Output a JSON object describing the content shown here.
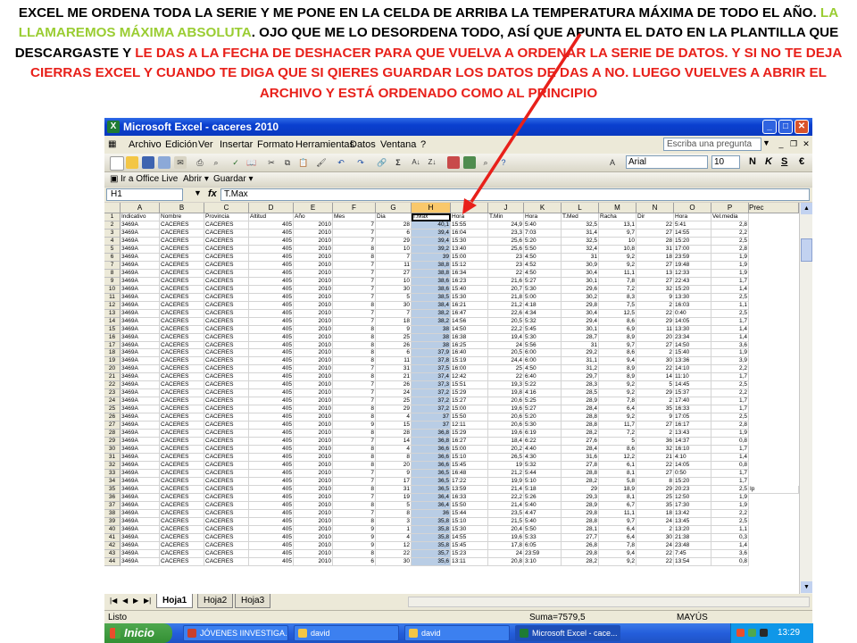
{
  "caption": {
    "part1": "EXCEL ME ORDENA TODA LA SERIE Y ME PONE EN LA CELDA DE ARRIBA LA TEMPERATURA MÁXIMA DE TODO EL AÑO.",
    "part2": "LA LLAMAREMOS MÁXIMA ABSOLUTA",
    "part3": ". OJO QUE ME LO DESORDENA TODO, ASÍ QUE APUNTA EL DATO EN LA PLANTILLA QUE DESCARGASTE Y",
    "part4": "LE DAS A LA FECHA DE DESHACER PARA QUE VUELVA A ORDENAR LA SERIE DE DATOS. Y SI NO TE DEJA CIERRAS EXCEL Y CUANDO TE DIGA QUE SI QIERES GUARDAR LOS DATOS DE DAS A NO. LUEGO VUELVES A ABRIR EL ARCHIVO Y ESTÁ ORDENADO COMO AL PRINCIPIO",
    "colors": {
      "black": "#000000",
      "green": "#9ACD32",
      "red": "#E8201A"
    }
  },
  "window": {
    "title": "Microsoft Excel - caceres 2010",
    "menu": [
      "Archivo",
      "Edición",
      "Ver",
      "Insertar",
      "Formato",
      "Herramientas",
      "Datos",
      "Ventana",
      "?"
    ],
    "help_placeholder": "Escriba una pregunta",
    "font_name": "Arial",
    "font_size": "10",
    "format_buttons": [
      "N",
      "K",
      "S",
      "€"
    ],
    "toolbar2": {
      "office_live": "Ir a Office Live",
      "open": "Abrir ▾",
      "save": "Guardar ▾"
    },
    "name_box": "H1",
    "fx_label": "fx",
    "formula_value": "T.Max"
  },
  "sheet": {
    "columns": [
      "A",
      "B",
      "C",
      "D",
      "E",
      "F",
      "G",
      "H",
      "I",
      "J",
      "K",
      "L",
      "M",
      "N",
      "O",
      "P"
    ],
    "partial_column_header": "Prec",
    "selected_column": "H",
    "header_row": [
      "Indicativo",
      "Nombre",
      "Provincia",
      "Altitud",
      "Año",
      "Mes",
      "Dia",
      "T.Max",
      "Hora",
      "T.Min",
      "Hora",
      "T.Med",
      "Racha",
      "Dir",
      "Hora",
      "Vel.media"
    ],
    "rows": [
      [
        "3469A",
        "CÁCERES",
        "CACERES",
        "405",
        "2010",
        "7",
        "28",
        "40,1",
        "15:55",
        "24,9",
        "5:40",
        "32,5",
        "13,1",
        "22",
        "5:41",
        "2,8"
      ],
      [
        "3469A",
        "CÁCERES",
        "CACERES",
        "405",
        "2010",
        "7",
        "6",
        "39,4",
        "16:04",
        "23,3",
        "7:03",
        "31,4",
        "9,7",
        "27",
        "14:55",
        "2,2"
      ],
      [
        "3469A",
        "CÁCERES",
        "CACERES",
        "405",
        "2010",
        "7",
        "29",
        "39,4",
        "15:30",
        "25,6",
        "5:20",
        "32,5",
        "10",
        "28",
        "15:20",
        "2,5"
      ],
      [
        "3469A",
        "CÁCERES",
        "CACERES",
        "405",
        "2010",
        "8",
        "10",
        "39,2",
        "13:40",
        "25,6",
        "5:50",
        "32,4",
        "10,8",
        "31",
        "17:00",
        "2,8"
      ],
      [
        "3469A",
        "CÁCERES",
        "CACERES",
        "405",
        "2010",
        "8",
        "7",
        "39",
        "15:00",
        "23",
        "4:50",
        "31",
        "9,2",
        "18",
        "23:59",
        "1,9"
      ],
      [
        "3469A",
        "CÁCERES",
        "CACERES",
        "405",
        "2010",
        "7",
        "11",
        "38,8",
        "15:12",
        "23",
        "4:52",
        "30,9",
        "9,2",
        "27",
        "19:48",
        "1,9"
      ],
      [
        "3469A",
        "CÁCERES",
        "CACERES",
        "405",
        "2010",
        "7",
        "27",
        "38,8",
        "16:34",
        "22",
        "4:50",
        "30,4",
        "11,1",
        "13",
        "12:33",
        "1,9"
      ],
      [
        "3469A",
        "CÁCERES",
        "CACERES",
        "405",
        "2010",
        "7",
        "10",
        "38,6",
        "16:23",
        "21,6",
        "5:27",
        "30,1",
        "7,8",
        "27",
        "22:43",
        "1,7"
      ],
      [
        "3469A",
        "CÁCERES",
        "CACERES",
        "405",
        "2010",
        "7",
        "30",
        "38,6",
        "15:40",
        "20,7",
        "5:30",
        "29,6",
        "7,2",
        "32",
        "15:20",
        "1,4"
      ],
      [
        "3469A",
        "CÁCERES",
        "CACERES",
        "405",
        "2010",
        "7",
        "5",
        "38,5",
        "15:30",
        "21,8",
        "5:00",
        "30,2",
        "8,3",
        "9",
        "13:30",
        "2,5"
      ],
      [
        "3469A",
        "CÁCERES",
        "CACERES",
        "405",
        "2010",
        "8",
        "30",
        "38,4",
        "16:21",
        "21,2",
        "4:18",
        "29,8",
        "7,5",
        "2",
        "16:03",
        "1,1"
      ],
      [
        "3469A",
        "CÁCERES",
        "CACERES",
        "405",
        "2010",
        "7",
        "7",
        "38,2",
        "16:47",
        "22,6",
        "4:34",
        "30,4",
        "12,5",
        "22",
        "0:40",
        "2,5"
      ],
      [
        "3469A",
        "CÁCERES",
        "CACERES",
        "405",
        "2010",
        "7",
        "18",
        "38,2",
        "14:56",
        "20,5",
        "5:32",
        "29,4",
        "8,6",
        "29",
        "14:05",
        "1,7"
      ],
      [
        "3469A",
        "CÁCERES",
        "CACERES",
        "405",
        "2010",
        "8",
        "9",
        "38",
        "14:50",
        "22,2",
        "5:45",
        "30,1",
        "6,9",
        "11",
        "13:30",
        "1,4"
      ],
      [
        "3469A",
        "CÁCERES",
        "CACERES",
        "405",
        "2010",
        "8",
        "25",
        "38",
        "16:38",
        "19,4",
        "5:30",
        "28,7",
        "8,9",
        "20",
        "23:34",
        "1,4"
      ],
      [
        "3469A",
        "CÁCERES",
        "CACERES",
        "405",
        "2010",
        "8",
        "26",
        "38",
        "16:25",
        "24",
        "5:56",
        "31",
        "9,7",
        "27",
        "14:50",
        "3,6"
      ],
      [
        "3469A",
        "CÁCERES",
        "CACERES",
        "405",
        "2010",
        "8",
        "6",
        "37,9",
        "16:40",
        "20,5",
        "6:00",
        "29,2",
        "8,6",
        "2",
        "15:40",
        "1,9"
      ],
      [
        "3469A",
        "CÁCERES",
        "CACERES",
        "405",
        "2010",
        "8",
        "11",
        "37,8",
        "15:19",
        "24,4",
        "6:00",
        "31,1",
        "9,4",
        "30",
        "13:36",
        "3,9"
      ],
      [
        "3469A",
        "CÁCERES",
        "CACERES",
        "405",
        "2010",
        "7",
        "31",
        "37,5",
        "16:00",
        "25",
        "4:50",
        "31,2",
        "8,9",
        "22",
        "14:10",
        "2,2"
      ],
      [
        "3469A",
        "CÁCERES",
        "CACERES",
        "405",
        "2010",
        "8",
        "21",
        "37,4",
        "12:42",
        "22",
        "6:40",
        "29,7",
        "8,9",
        "14",
        "11:10",
        "1,7"
      ],
      [
        "3469A",
        "CÁCERES",
        "CACERES",
        "405",
        "2010",
        "7",
        "26",
        "37,3",
        "15:51",
        "19,3",
        "5:22",
        "28,3",
        "9,2",
        "5",
        "14:45",
        "2,5"
      ],
      [
        "3469A",
        "CÁCERES",
        "CACERES",
        "405",
        "2010",
        "7",
        "24",
        "37,2",
        "15:29",
        "19,8",
        "4:16",
        "28,5",
        "9,2",
        "29",
        "15:37",
        "2,2"
      ],
      [
        "3469A",
        "CÁCERES",
        "CACERES",
        "405",
        "2010",
        "7",
        "25",
        "37,2",
        "15:27",
        "20,6",
        "5:25",
        "28,9",
        "7,8",
        "2",
        "17:40",
        "1,7"
      ],
      [
        "3469A",
        "CÁCERES",
        "CACERES",
        "405",
        "2010",
        "8",
        "29",
        "37,2",
        "15:00",
        "19,6",
        "5:27",
        "28,4",
        "6,4",
        "35",
        "16:33",
        "1,7"
      ],
      [
        "3469A",
        "CÁCERES",
        "CACERES",
        "405",
        "2010",
        "8",
        "4",
        "37",
        "15:50",
        "20,6",
        "5:20",
        "28,8",
        "9,2",
        "9",
        "17:05",
        "2,5"
      ],
      [
        "3469A",
        "CÁCERES",
        "CACERES",
        "405",
        "2010",
        "9",
        "15",
        "37",
        "12:11",
        "20,6",
        "5:30",
        "28,8",
        "11,7",
        "27",
        "16:17",
        "2,8"
      ],
      [
        "3469A",
        "CÁCERES",
        "CACERES",
        "405",
        "2010",
        "8",
        "28",
        "36,8",
        "15:29",
        "19,6",
        "6:19",
        "28,2",
        "7,2",
        "2",
        "13:43",
        "1,9"
      ],
      [
        "3469A",
        "CÁCERES",
        "CACERES",
        "405",
        "2010",
        "7",
        "14",
        "36,8",
        "16:27",
        "18,4",
        "6:22",
        "27,6",
        "5",
        "36",
        "14:37",
        "0,8"
      ],
      [
        "3469A",
        "CÁCERES",
        "CACERES",
        "405",
        "2010",
        "8",
        "4",
        "36,6",
        "15:00",
        "20,2",
        "4:40",
        "28,4",
        "8,6",
        "32",
        "16:10",
        "1,7"
      ],
      [
        "3469A",
        "CÁCERES",
        "CACERES",
        "405",
        "2010",
        "8",
        "8",
        "36,6",
        "15:10",
        "26,5",
        "4:30",
        "31,6",
        "12,2",
        "21",
        "4:10",
        "1,4"
      ],
      [
        "3469A",
        "CÁCERES",
        "CACERES",
        "405",
        "2010",
        "8",
        "20",
        "36,6",
        "15:45",
        "19",
        "5:32",
        "27,8",
        "6,1",
        "22",
        "14:05",
        "0,8"
      ],
      [
        "3469A",
        "CÁCERES",
        "CACERES",
        "405",
        "2010",
        "7",
        "9",
        "36,5",
        "16:48",
        "21,2",
        "5:44",
        "28,8",
        "8,1",
        "27",
        "0:50",
        "1,7"
      ],
      [
        "3469A",
        "CÁCERES",
        "CACERES",
        "405",
        "2010",
        "7",
        "17",
        "36,5",
        "17:22",
        "19,9",
        "5:10",
        "28,2",
        "5,8",
        "8",
        "15:20",
        "1,7"
      ],
      [
        "3469A",
        "CÁCERES",
        "CACERES",
        "405",
        "2010",
        "8",
        "31",
        "36,5",
        "13:59",
        "21,4",
        "5:18",
        "29",
        "18,9",
        "29",
        "20:23",
        "2,5"
      ],
      [
        "3469A",
        "CÁCERES",
        "CACERES",
        "405",
        "2010",
        "7",
        "19",
        "36,4",
        "16:33",
        "22,2",
        "5:26",
        "29,3",
        "8,1",
        "25",
        "12:50",
        "1,9"
      ],
      [
        "3469A",
        "CÁCERES",
        "CACERES",
        "405",
        "2010",
        "8",
        "5",
        "36,4",
        "15:50",
        "21,4",
        "5:40",
        "28,9",
        "6,7",
        "35",
        "17:30",
        "1,9"
      ],
      [
        "3469A",
        "CÁCERES",
        "CACERES",
        "405",
        "2010",
        "7",
        "8",
        "36",
        "15:44",
        "23,5",
        "4:47",
        "29,8",
        "11,1",
        "18",
        "13:42",
        "2,2"
      ],
      [
        "3469A",
        "CÁCERES",
        "CACERES",
        "405",
        "2010",
        "8",
        "3",
        "35,8",
        "15:10",
        "21,5",
        "5:40",
        "28,8",
        "9,7",
        "24",
        "13:45",
        "2,5"
      ],
      [
        "3469A",
        "CÁCERES",
        "CACERES",
        "405",
        "2010",
        "9",
        "1",
        "35,8",
        "15:30",
        "20,4",
        "5:50",
        "28,1",
        "6,4",
        "2",
        "13:20",
        "1,1"
      ],
      [
        "3469A",
        "CÁCERES",
        "CACERES",
        "405",
        "2010",
        "9",
        "4",
        "35,8",
        "14:55",
        "19,6",
        "5:33",
        "27,7",
        "6,4",
        "30",
        "21:38",
        "0,3"
      ],
      [
        "3469A",
        "CÁCERES",
        "CACERES",
        "405",
        "2010",
        "9",
        "12",
        "35,8",
        "15:45",
        "17,8",
        "6:05",
        "26,8",
        "7,8",
        "24",
        "23:48",
        "1,4"
      ],
      [
        "3469A",
        "CÁCERES",
        "CACERES",
        "405",
        "2010",
        "8",
        "22",
        "35,7",
        "15:23",
        "24",
        "23:59",
        "29,8",
        "9,4",
        "22",
        "7:45",
        "3,6"
      ],
      [
        "3469A",
        "CÁCERES",
        "CACERES",
        "405",
        "2010",
        "6",
        "30",
        "35,6",
        "13:11",
        "20,8",
        "3:10",
        "28,2",
        "9,2",
        "22",
        "13:54",
        "0,8"
      ]
    ],
    "extra_cell": {
      "row": 35,
      "text": "Ip"
    },
    "tabs": [
      "Hoja1",
      "Hoja2",
      "Hoja3"
    ]
  },
  "status": {
    "text": "Listo",
    "sum": "Suma=7579,5",
    "caps": "MAYÚS"
  },
  "taskbar": {
    "start": "Inicio",
    "items": [
      "JÓVENES IINVESTIGA...",
      "david",
      "david",
      "Microsoft Excel - cace..."
    ],
    "clock": "13:29"
  }
}
